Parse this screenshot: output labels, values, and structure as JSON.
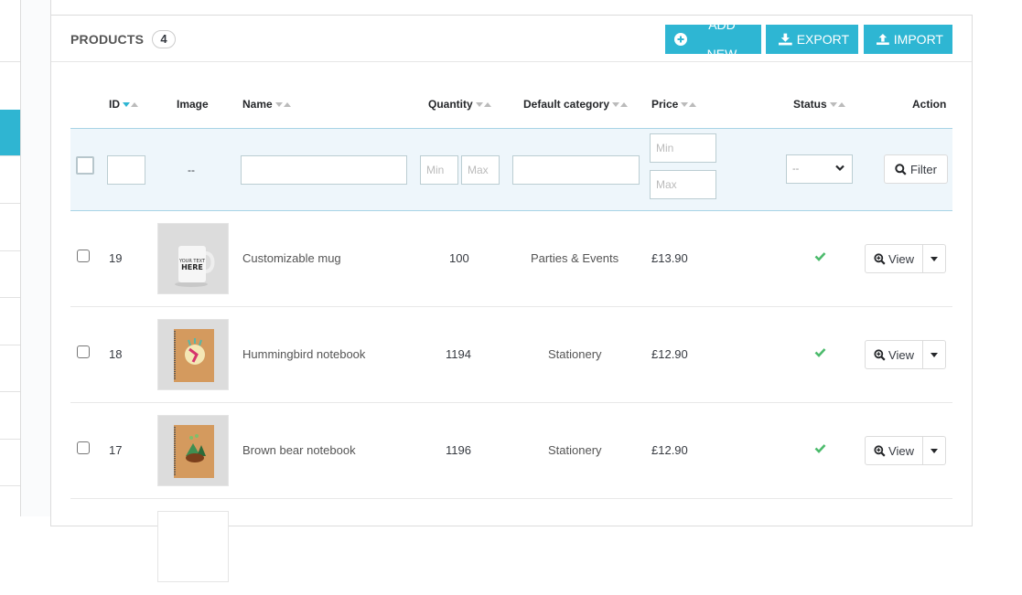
{
  "panel": {
    "title": "PRODUCTS",
    "count": "4",
    "buttons": {
      "add_new": "ADD NEW",
      "export": "EXPORT",
      "import": "IMPORT"
    }
  },
  "colors": {
    "accent": "#2eb6d3",
    "status_ok": "#4cbb6c",
    "filter_bg": "#eef6fb"
  },
  "table": {
    "columns": {
      "id": "ID",
      "image": "Image",
      "name": "Name",
      "quantity": "Quantity",
      "category": "Default category",
      "price": "Price",
      "status": "Status",
      "action": "Action"
    },
    "filters": {
      "image_placeholder": "--",
      "qty_min": "Min",
      "qty_max": "Max",
      "price_min": "Min",
      "price_max": "Max",
      "status_selected": "--",
      "filter_button": "Filter"
    },
    "rows": [
      {
        "id": "19",
        "name": "Customizable mug",
        "quantity": "100",
        "category": "Parties & Events",
        "price": "£13.90",
        "status": "enabled",
        "action": "View",
        "image": "mug-image"
      },
      {
        "id": "18",
        "name": "Hummingbird notebook",
        "quantity": "1194",
        "category": "Stationery",
        "price": "£12.90",
        "status": "enabled",
        "action": "View",
        "image": "hummingbird-notebook-image"
      },
      {
        "id": "17",
        "name": "Brown bear notebook",
        "quantity": "1196",
        "category": "Stationery",
        "price": "£12.90",
        "status": "enabled",
        "action": "View",
        "image": "bear-notebook-image"
      }
    ]
  }
}
